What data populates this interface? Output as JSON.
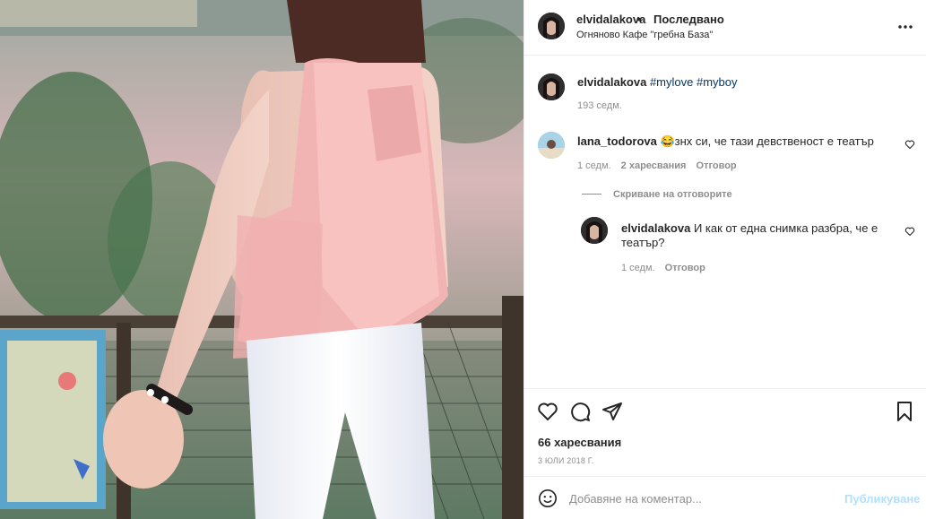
{
  "header": {
    "username": "elvidalakova",
    "separator": "•",
    "follow_state": "Последвано",
    "location": "Огняново Кафе \"гребна База\""
  },
  "caption": {
    "username": "elvidalakova",
    "hashtags": "#mylove #myboy",
    "time": "193 седм."
  },
  "comments": [
    {
      "username": "lana_todorova",
      "text": "😂знх си, че тази девственост е театър",
      "time": "1 седм.",
      "likes": "2 харесвания",
      "reply": "Отговор",
      "hide_replies": "Скриване на отговорите",
      "replies": [
        {
          "username": "elvidalakova",
          "text": "И как от една снимка разбра, че е театър?",
          "time": "1 седм.",
          "reply": "Отговор"
        }
      ]
    }
  ],
  "actions": {
    "likes": "66 харесвания",
    "date": "3 ЮЛИ 2018 Г."
  },
  "add_comment": {
    "placeholder": "Добавяне на коментар...",
    "publish": "Публикуване"
  },
  "icons": [
    "more-icon",
    "heart-icon",
    "comment-icon",
    "share-icon",
    "bookmark-icon",
    "emoji-icon"
  ]
}
